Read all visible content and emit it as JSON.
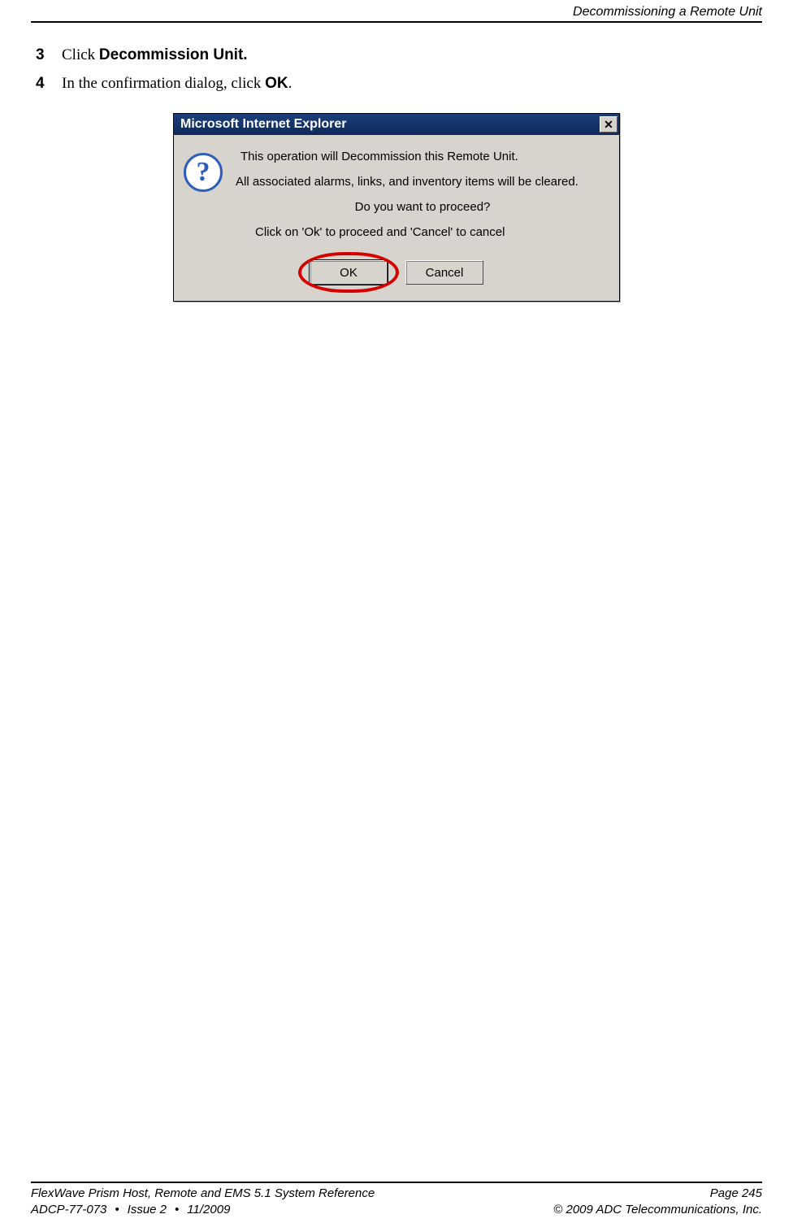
{
  "header": {
    "title": "Decommissioning a Remote Unit"
  },
  "steps": [
    {
      "num": "3",
      "prefix": "Click ",
      "bold": "Decommission Unit."
    },
    {
      "num": "4",
      "prefix": "In the confirmation dialog, click ",
      "bold": "OK",
      "suffix": "."
    }
  ],
  "dialog": {
    "title": "Microsoft Internet Explorer",
    "close_glyph": "✕",
    "icon_glyph": "?",
    "msg1": "This operation will Decommission this Remote Unit.",
    "msg2": "All associated alarms, links, and inventory items will be cleared.",
    "msg3": "Do you want to proceed?",
    "msg4": "Click on 'Ok' to proceed and 'Cancel' to cancel",
    "ok_label": "OK",
    "cancel_label": "Cancel"
  },
  "footer": {
    "ref_line": "FlexWave Prism Host, Remote and EMS 5.1 System Reference",
    "page_line": "Page 245",
    "doc_id": "ADCP-77-073",
    "issue": "Issue 2",
    "date": "11/2009",
    "copyright": "© 2009 ADC Telecommunications, Inc."
  }
}
